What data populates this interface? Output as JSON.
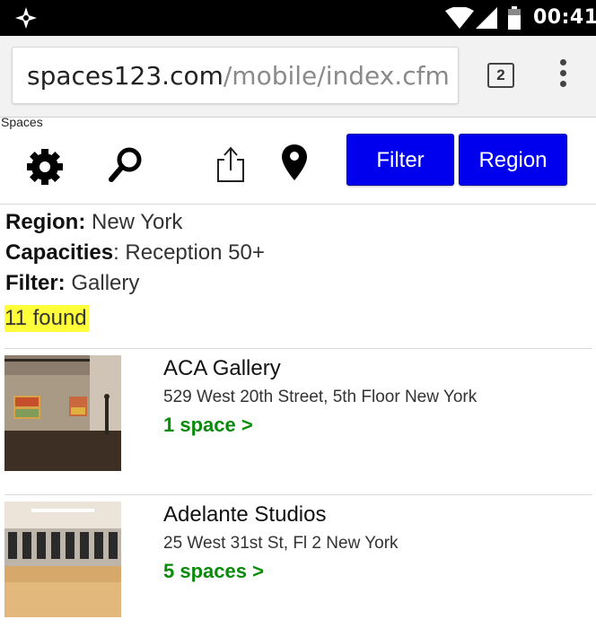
{
  "status_bar": {
    "time": "00:41",
    "icons": [
      "app-notification-icon",
      "wifi-icon",
      "cell-signal-icon",
      "battery-icon"
    ]
  },
  "browser": {
    "url_host": "spaces123.com",
    "url_path": "/mobile/index.cfm",
    "tab_count": "2"
  },
  "header": {
    "site_label": "Spaces",
    "filter_button": "Filter",
    "region_button": "Region",
    "icons": [
      "settings-icon",
      "search-icon",
      "share-icon",
      "location-pin-icon"
    ]
  },
  "criteria": {
    "region_label": "Region:",
    "region_value": " New York",
    "capacities_label": "Capacities",
    "capacities_value": ": Reception 50+",
    "filter_label": "Filter:",
    "filter_value": " Gallery",
    "found": "11 found"
  },
  "listings": [
    {
      "name": "ACA Gallery",
      "address": "529 West 20th Street, 5th Floor New York",
      "spaces": "1 space >"
    },
    {
      "name": "Adelante Studios",
      "address": "25 West 31st St, Fl 2 New York",
      "spaces": "5 spaces >"
    }
  ],
  "colors": {
    "button_blue": "#0000ee",
    "link_green": "#0a8a0a",
    "highlight_yellow": "#ffff3a"
  }
}
